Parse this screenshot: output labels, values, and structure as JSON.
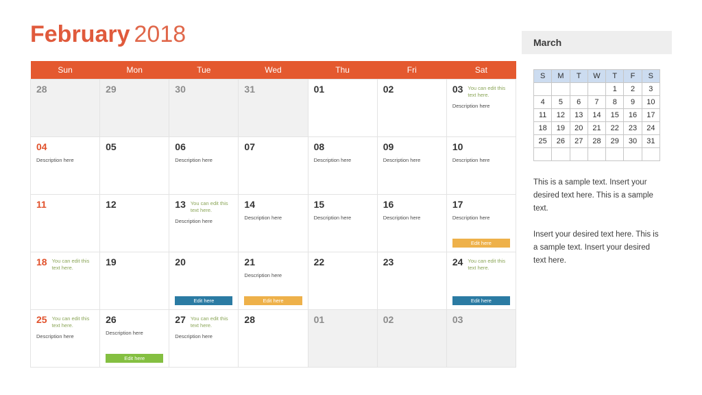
{
  "title": {
    "month": "February",
    "year": "2018"
  },
  "calendar": {
    "weekday_headers": [
      "Sun",
      "Mon",
      "Tue",
      "Wed",
      "Thu",
      "Fri",
      "Sat"
    ],
    "edit_note": "You can edit this text here.",
    "description": "Description here",
    "edit_button_label": "Edit here",
    "colors": {
      "header_bg": "#e4592f",
      "sunday_text": "#e1512b",
      "muted_cell_bg": "#f1f1f1",
      "note_text": "#8aa557",
      "button_blue": "#2b7ba3",
      "button_amber": "#eeb14a",
      "button_green": "#84bf41"
    },
    "weeks": [
      [
        {
          "day": "28",
          "muted": true
        },
        {
          "day": "29",
          "muted": true
        },
        {
          "day": "30",
          "muted": true
        },
        {
          "day": "31",
          "muted": true
        },
        {
          "day": "01"
        },
        {
          "day": "02"
        },
        {
          "day": "03",
          "note": "You can edit this text here.",
          "desc": "Description here"
        }
      ],
      [
        {
          "day": "04",
          "sunday": true,
          "desc": "Description here"
        },
        {
          "day": "05"
        },
        {
          "day": "06",
          "desc": "Description here"
        },
        {
          "day": "07"
        },
        {
          "day": "08",
          "desc": "Description here"
        },
        {
          "day": "09",
          "desc": "Description here"
        },
        {
          "day": "10",
          "desc": "Description here"
        }
      ],
      [
        {
          "day": "11",
          "sunday": true
        },
        {
          "day": "12"
        },
        {
          "day": "13",
          "note": "You can edit this text here.",
          "desc": "Description here"
        },
        {
          "day": "14",
          "desc": "Description here"
        },
        {
          "day": "15",
          "desc": "Description here"
        },
        {
          "day": "16",
          "desc": "Description here"
        },
        {
          "day": "17",
          "desc": "Description here",
          "button": {
            "label": "Edit here",
            "color": "amber"
          }
        }
      ],
      [
        {
          "day": "18",
          "sunday": true,
          "note": "You can edit this text here."
        },
        {
          "day": "19"
        },
        {
          "day": "20",
          "button": {
            "label": "Edit here",
            "color": "blue"
          }
        },
        {
          "day": "21",
          "desc": "Description here",
          "button": {
            "label": "Edit here",
            "color": "amber"
          }
        },
        {
          "day": "22"
        },
        {
          "day": "23"
        },
        {
          "day": "24",
          "note": "You can edit this text here.",
          "button": {
            "label": "Edit here",
            "color": "blue"
          }
        }
      ],
      [
        {
          "day": "25",
          "sunday": true,
          "note": "You can edit this text here.",
          "desc": "Description here"
        },
        {
          "day": "26",
          "desc": "Description here",
          "button": {
            "label": "Edit here",
            "color": "green"
          }
        },
        {
          "day": "27",
          "note": "You can edit this text here.",
          "desc": "Description here"
        },
        {
          "day": "28"
        },
        {
          "day": "01",
          "muted": true
        },
        {
          "day": "02",
          "muted": true
        },
        {
          "day": "03",
          "muted": true
        }
      ]
    ]
  },
  "sidebar": {
    "title": "March",
    "mini_calendar": {
      "weekday_headers": [
        "S",
        "M",
        "T",
        "W",
        "T",
        "F",
        "S"
      ],
      "weeks": [
        [
          "",
          "",
          "",
          "",
          "1",
          "2",
          "3"
        ],
        [
          "4",
          "5",
          "6",
          "7",
          "8",
          "9",
          "10"
        ],
        [
          "11",
          "12",
          "13",
          "14",
          "15",
          "16",
          "17"
        ],
        [
          "18",
          "19",
          "20",
          "21",
          "22",
          "23",
          "24"
        ],
        [
          "25",
          "26",
          "27",
          "28",
          "29",
          "30",
          "31"
        ],
        [
          "",
          "",
          "",
          "",
          "",
          "",
          ""
        ]
      ]
    },
    "paragraphs": [
      "This is a sample text. Insert your desired text here. This is a sample text.",
      "Insert your desired text here. This is a sample text. Insert your desired text here."
    ]
  }
}
